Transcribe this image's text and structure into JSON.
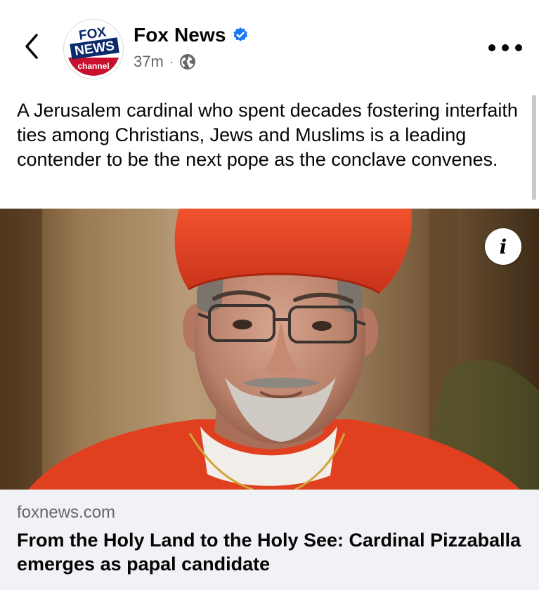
{
  "header": {
    "page_name": "Fox News",
    "timestamp": "37m",
    "separator": "·",
    "avatar": {
      "line1": "FOX",
      "line2": "NEWS",
      "line3": "channel"
    },
    "verified": true,
    "audience_icon": "globe-icon",
    "back_icon": "chevron-left-icon",
    "more_icon": "more-horizontal-icon"
  },
  "post": {
    "text": "A Jerusalem cardinal who spent decades fostering interfaith ties among Christians, Jews and Muslims is a leading contender to be the next pope as the conclave convenes."
  },
  "media": {
    "info_label": "i"
  },
  "link_preview": {
    "domain": "foxnews.com",
    "headline": "From the Holy Land to the Holy See: Cardinal Pizzaballa emerges as papal candidate"
  },
  "colors": {
    "verified_blue": "#1877f2",
    "meta_gray": "#65676b",
    "card_bg": "#f0f2f5",
    "fox_red": "#c8102e",
    "fox_navy": "#0a2a6b"
  }
}
